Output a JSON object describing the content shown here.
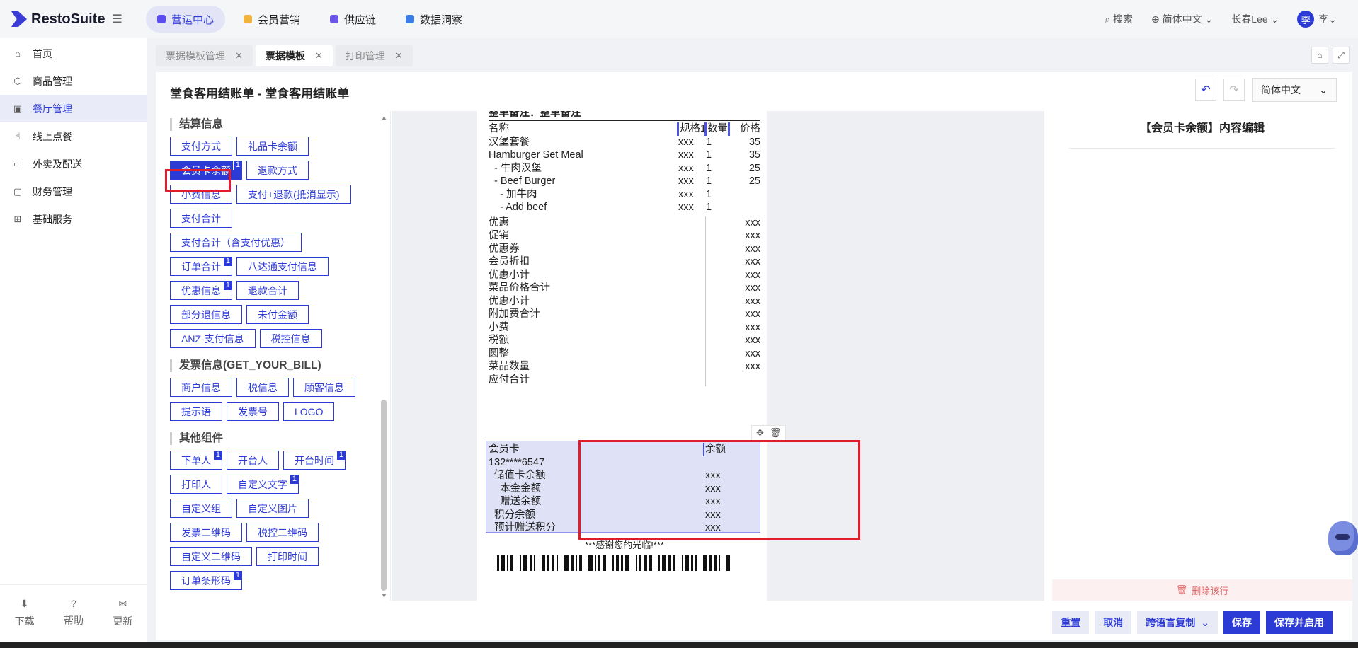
{
  "brand": {
    "name": "RestoSuite"
  },
  "topnav": {
    "items": [
      {
        "label": "营运中心",
        "color": "#5b4cf0"
      },
      {
        "label": "会员营销",
        "color": "#f0b43c"
      },
      {
        "label": "供应链",
        "color": "#6b56e8"
      },
      {
        "label": "数据洞察",
        "color": "#3a7de8"
      }
    ],
    "search": "搜索",
    "language": "简体中文",
    "store": "长春Lee",
    "avatar_char": "李",
    "user": "李"
  },
  "sidebar": {
    "items": [
      {
        "label": "首页",
        "icon": "⌂"
      },
      {
        "label": "商品管理",
        "icon": "⬡"
      },
      {
        "label": "餐厅管理",
        "icon": "▣"
      },
      {
        "label": "线上点餐",
        "icon": "☝"
      },
      {
        "label": "外卖及配送",
        "icon": "▭"
      },
      {
        "label": "财务管理",
        "icon": "▢"
      },
      {
        "label": "基础服务",
        "icon": "⊞"
      }
    ],
    "footer": [
      {
        "label": "下载",
        "icon": "⬇"
      },
      {
        "label": "帮助",
        "icon": "?"
      },
      {
        "label": "更新",
        "icon": "✉"
      }
    ]
  },
  "tabs": [
    "票据模板管理",
    "票据模板",
    "打印管理"
  ],
  "page": {
    "title": "堂食客用结账单 - 堂食客用结账单",
    "language": "简体中文"
  },
  "components": {
    "settlement": {
      "title": "结算信息",
      "rows": [
        [
          {
            "label": "支付方式"
          },
          {
            "label": "礼品卡余额"
          }
        ],
        [
          {
            "label": "会员卡余额",
            "badge": "1",
            "selected": true
          },
          {
            "label": "退款方式"
          }
        ],
        [
          {
            "label": "小费信息"
          },
          {
            "label": "支付+退款(抵消显示)"
          }
        ],
        [
          {
            "label": "支付合计"
          }
        ],
        [
          {
            "label": "支付合计（含支付优惠）"
          }
        ],
        [
          {
            "label": "订单合计",
            "badge": "1"
          },
          {
            "label": "八达通支付信息"
          }
        ],
        [
          {
            "label": "优惠信息",
            "badge": "1"
          },
          {
            "label": "退款合计"
          }
        ],
        [
          {
            "label": "部分退信息"
          },
          {
            "label": "未付金额"
          }
        ],
        [
          {
            "label": "ANZ-支付信息"
          },
          {
            "label": "税控信息"
          }
        ]
      ]
    },
    "invoice": {
      "title": "发票信息(GET_YOUR_BILL)",
      "rows": [
        [
          {
            "label": "商户信息"
          },
          {
            "label": "税信息"
          },
          {
            "label": "顾客信息"
          }
        ],
        [
          {
            "label": "提示语"
          },
          {
            "label": "发票号"
          },
          {
            "label": "LOGO"
          }
        ]
      ]
    },
    "other": {
      "title": "其他组件",
      "rows": [
        [
          {
            "label": "下单人",
            "badge": "1"
          },
          {
            "label": "开台人"
          },
          {
            "label": "开台时间",
            "badge": "1"
          }
        ],
        [
          {
            "label": "打印人"
          },
          {
            "label": "自定义文字",
            "badge": "1"
          }
        ],
        [
          {
            "label": "自定义组"
          },
          {
            "label": "自定义图片"
          }
        ],
        [
          {
            "label": "发票二维码"
          },
          {
            "label": "税控二维码"
          }
        ],
        [
          {
            "label": "自定义二维码"
          },
          {
            "label": "打印时间"
          }
        ],
        [
          {
            "label": "订单条形码",
            "badge": "1"
          }
        ]
      ]
    }
  },
  "receipt": {
    "remark": "整单备注：整单备注",
    "header": {
      "name": "名称",
      "spec": "规格1",
      "qty": "数量",
      "price": "价格"
    },
    "items": [
      {
        "name": "汉堡套餐",
        "spec": "xxx",
        "qty": "1",
        "price": "35"
      },
      {
        "name": "Hamburger Set Meal",
        "spec": "xxx",
        "qty": "1",
        "price": "35"
      },
      {
        "name": "  - 牛肉汉堡",
        "spec": "xxx",
        "qty": "1",
        "price": "25"
      },
      {
        "name": "  - Beef Burger",
        "spec": "xxx",
        "qty": "1",
        "price": "25"
      },
      {
        "name": "    - 加牛肉",
        "spec": "xxx",
        "qty": "1",
        "price": ""
      },
      {
        "name": "    - Add beef",
        "spec": "xxx",
        "qty": "1",
        "price": ""
      }
    ],
    "summary": [
      {
        "label": "优惠",
        "value": "xxx"
      },
      {
        "label": "促销",
        "value": "xxx"
      },
      {
        "label": "优惠券",
        "value": "xxx"
      },
      {
        "label": "会员折扣",
        "value": "xxx"
      },
      {
        "label": "优惠小计",
        "value": "xxx"
      },
      {
        "label": "菜品价格合计",
        "value": "xxx"
      },
      {
        "label": "优惠小计",
        "value": "xxx"
      },
      {
        "label": "附加费合计",
        "value": "xxx"
      },
      {
        "label": "小费",
        "value": "xxx"
      },
      {
        "label": "税额",
        "value": "xxx"
      },
      {
        "label": "圆整",
        "value": "xxx"
      },
      {
        "label": "菜品数量",
        "value": "xxx"
      },
      {
        "label": "应付合计",
        "value": ""
      }
    ],
    "member": {
      "header_left": "会员卡",
      "header_right": "余额",
      "card_no": "132****6547",
      "rows": [
        {
          "label": "  储值卡余额",
          "value": "xxx"
        },
        {
          "label": "    本金金额",
          "value": "xxx"
        },
        {
          "label": "    赠送余额",
          "value": "xxx"
        },
        {
          "label": "  积分余额",
          "value": "xxx"
        },
        {
          "label": "  预计赠送积分",
          "value": "xxx"
        }
      ]
    },
    "thanks": "***感谢您的光临!***"
  },
  "editor": {
    "title": "【会员卡余额】内容编辑",
    "delete": "删除该行"
  },
  "actions": {
    "reset": "重置",
    "cancel": "取消",
    "cross_lang": "跨语言复制",
    "save": "保存",
    "save_enable": "保存并启用"
  }
}
